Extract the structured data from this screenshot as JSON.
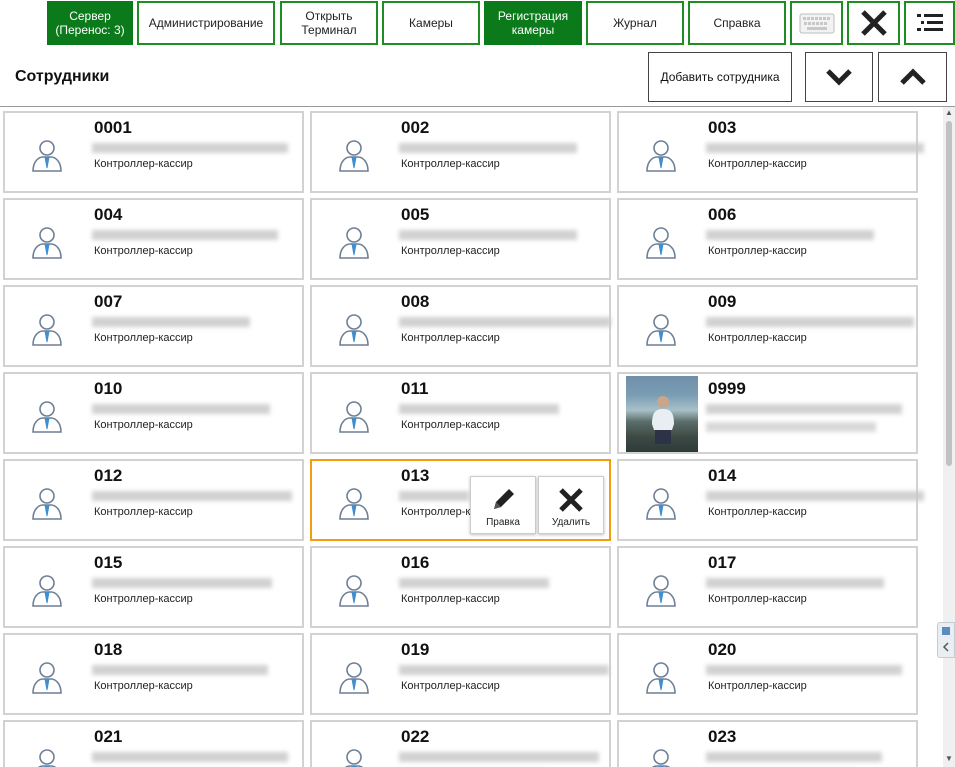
{
  "nav": {
    "server": "Сервер\n(Перенос: 3)",
    "admin": "Администрирование",
    "terminal": "Открыть\nТерминал",
    "cameras": "Камеры",
    "registration": "Регистрация\nкамеры",
    "journal": "Журнал",
    "help": "Справка"
  },
  "header": {
    "title": "Сотрудники",
    "add_employee": "Добавить сотрудника"
  },
  "employees": [
    {
      "code": "0001",
      "role": "Контроллер-кассир"
    },
    {
      "code": "002",
      "role": "Контроллер-кассир"
    },
    {
      "code": "003",
      "role": "Контроллер-кассир"
    },
    {
      "code": "004",
      "role": "Контроллер-кассир"
    },
    {
      "code": "005",
      "role": "Контроллер-кассир"
    },
    {
      "code": "006",
      "role": "Контроллер-кассир"
    },
    {
      "code": "007",
      "role": "Контроллер-кассир"
    },
    {
      "code": "008",
      "role": "Контроллер-кассир"
    },
    {
      "code": "009",
      "role": "Контроллер-кассир"
    },
    {
      "code": "010",
      "role": "Контроллер-кассир"
    },
    {
      "code": "011",
      "role": "Контроллер-кассир"
    },
    {
      "code": "0999",
      "role": ""
    },
    {
      "code": "012",
      "role": "Контроллер-кассир"
    },
    {
      "code": "013",
      "role": "Контроллер-к"
    },
    {
      "code": "014",
      "role": "Контроллер-кассир"
    },
    {
      "code": "015",
      "role": "Контроллер-кассир"
    },
    {
      "code": "016",
      "role": "Контроллер-кассир"
    },
    {
      "code": "017",
      "role": "Контроллер-кассир"
    },
    {
      "code": "018",
      "role": "Контроллер-кассир"
    },
    {
      "code": "019",
      "role": "Контроллер-кассир"
    },
    {
      "code": "020",
      "role": "Контроллер-кассир"
    },
    {
      "code": "021",
      "role": ""
    },
    {
      "code": "022",
      "role": ""
    },
    {
      "code": "023",
      "role": ""
    }
  ],
  "card_actions": {
    "edit": "Правка",
    "delete": "Удалить"
  },
  "colors": {
    "accent_green": "#0b7a1a",
    "selected_border": "#f39c12"
  }
}
